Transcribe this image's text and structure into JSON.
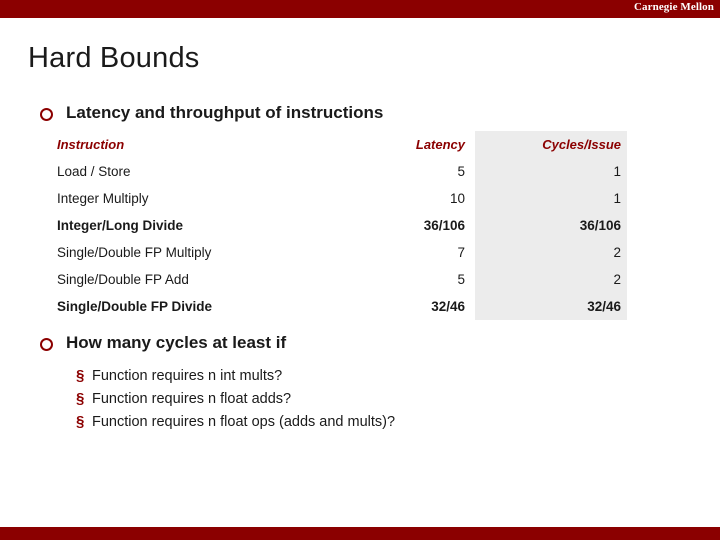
{
  "header": {
    "institution": "Carnegie Mellon"
  },
  "slide": {
    "title": "Hard Bounds",
    "bullets": [
      {
        "label": "Latency and throughput of instructions"
      },
      {
        "label": "How many cycles at least if"
      }
    ]
  },
  "table": {
    "headers": [
      "Instruction",
      "Latency",
      "Cycles/Issue"
    ],
    "rows": [
      {
        "instruction": "Load / Store",
        "latency": "5",
        "cycles": "1",
        "bold": false
      },
      {
        "instruction": "Integer Multiply",
        "latency": "10",
        "cycles": "1",
        "bold": false
      },
      {
        "instruction": "Integer/Long Divide",
        "latency": "36/106",
        "cycles": "36/106",
        "bold": true
      },
      {
        "instruction": "Single/Double FP Multiply",
        "latency": "7",
        "cycles": "2",
        "bold": false
      },
      {
        "instruction": "Single/Double FP Add",
        "latency": "5",
        "cycles": "2",
        "bold": false
      },
      {
        "instruction": "Single/Double FP Divide",
        "latency": "32/46",
        "cycles": "32/46",
        "bold": true
      }
    ]
  },
  "sub_bullets": [
    {
      "marker": "§",
      "text": "Function requires n int mults?"
    },
    {
      "marker": "§",
      "text": "Function requires n float adds?"
    },
    {
      "marker": "§",
      "text": "Function requires n float ops (adds and mults)?"
    }
  ],
  "colors": {
    "accent": "#8b0000",
    "shade": "#ececec",
    "text": "#1a1a1a"
  }
}
